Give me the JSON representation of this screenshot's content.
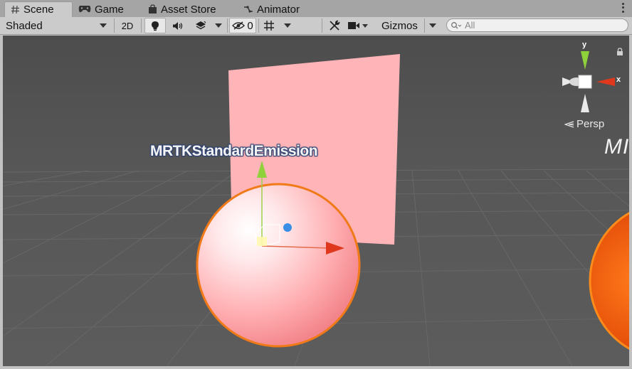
{
  "tabs": [
    {
      "label": "Scene",
      "icon": "hash-icon",
      "active": true
    },
    {
      "label": "Game",
      "icon": "gamepad-icon",
      "active": false
    },
    {
      "label": "Asset Store",
      "icon": "shopping-bag-icon",
      "active": false
    },
    {
      "label": "Animator",
      "icon": "animator-icon",
      "active": false
    }
  ],
  "toolbar": {
    "draw_mode": "Shaded",
    "toggle_2d": "2D",
    "hidden_count": "0",
    "gizmos_label": "Gizmos",
    "search_placeholder": "All"
  },
  "viewport": {
    "object_label": "MRTKStandardEmission",
    "projection_label": "Persp",
    "axis_x": "x",
    "axis_y": "y",
    "partial_text": "MI"
  }
}
